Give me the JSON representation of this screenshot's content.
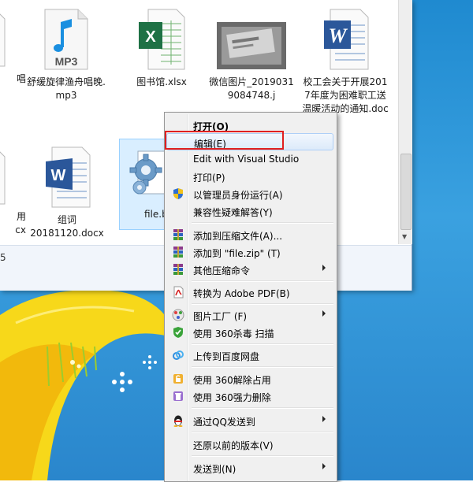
{
  "explorer": {
    "files": [
      {
        "id": "f1",
        "name": "唱",
        "icon": "generic-file-icon"
      },
      {
        "id": "f2",
        "name": "舒缓旋律渔舟唱晚.mp3",
        "icon": "mp3-file-icon"
      },
      {
        "id": "f3",
        "name": "图书馆.xlsx",
        "icon": "excel-file-icon"
      },
      {
        "id": "f4",
        "name": "微信图片_20190319084748.j",
        "icon": "image-thumbnail-icon"
      },
      {
        "id": "f5",
        "name": "校工会关于开展2017年度为困难职工送温暖活动的通知.doc",
        "icon": "word-doc-icon"
      },
      {
        "id": "f6",
        "name": "用\ncx",
        "icon": "generic-file-icon"
      },
      {
        "id": "f7",
        "name": "组词\n20181120.docx",
        "icon": "word-docx-icon"
      },
      {
        "id": "f8",
        "name": "file.b",
        "icon": "config-gear-file-icon"
      }
    ],
    "status_count": "5"
  },
  "context_menu": {
    "items": [
      {
        "label": "打开(O)",
        "bold": true
      },
      {
        "label": "编辑(E)",
        "highlighted": true
      },
      {
        "label": "Edit with Visual Studio"
      },
      {
        "label": "打印(P)"
      },
      {
        "label": "以管理员身份运行(A)",
        "icon": "uac-shield-icon"
      },
      {
        "label": "兼容性疑难解答(Y)"
      },
      {
        "label": "添加到压缩文件(A)...",
        "icon": "winrar-icon"
      },
      {
        "label": "添加到 \"file.zip\" (T)",
        "icon": "winrar-icon"
      },
      {
        "label": "其他压缩命令",
        "icon": "winrar-icon",
        "submenu": true
      },
      {
        "label": "转换为 Adobe PDF(B)",
        "icon": "adobe-pdf-icon"
      },
      {
        "label": "图片工厂 (F)",
        "icon": "picture-factory-icon",
        "submenu": true
      },
      {
        "label": "使用 360杀毒 扫描",
        "icon": "360-antivirus-icon"
      },
      {
        "label": "上传到百度网盘",
        "icon": "baidu-netdisk-icon"
      },
      {
        "label": "使用 360解除占用",
        "icon": "360-unlock-icon"
      },
      {
        "label": "使用 360强力删除",
        "icon": "360-delete-icon"
      },
      {
        "label": "通过QQ发送到",
        "icon": "qq-penguin-icon",
        "submenu": true
      },
      {
        "label": "还原以前的版本(V)"
      },
      {
        "label": "发送到(N)",
        "submenu": true
      }
    ]
  },
  "colors": {
    "highlight_outline": "#e02020",
    "selection_fill": "#cce8ff",
    "desktop_blue": "#2a8fd6",
    "excel_green": "#1e7145",
    "word_blue": "#2b579a"
  }
}
